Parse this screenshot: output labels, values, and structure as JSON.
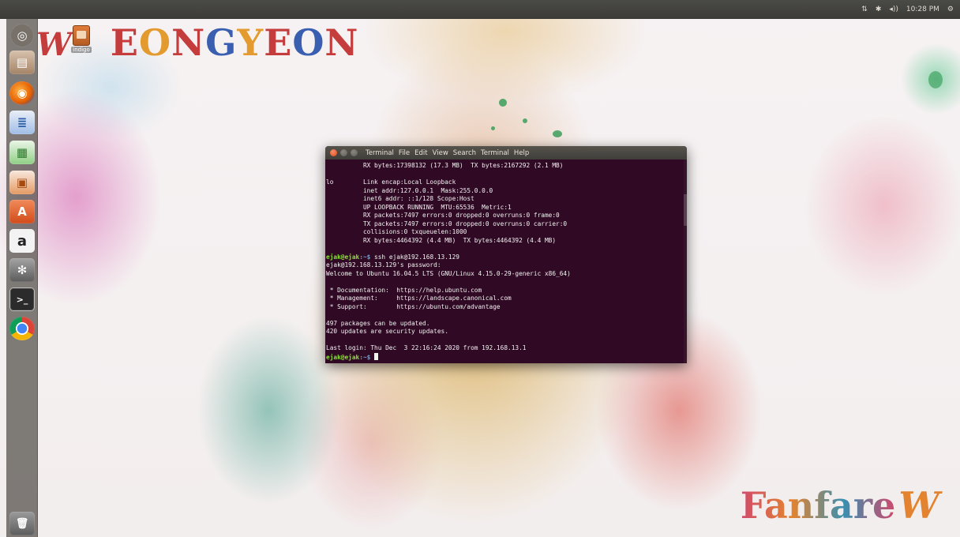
{
  "top_panel": {
    "indicators": {
      "network": "⇅",
      "bluetooth": "✱",
      "volume": "◂))",
      "clock": "10:28 PM",
      "settings": "⚙"
    }
  },
  "launcher": {
    "items": [
      {
        "name": "dash-home",
        "icon": "ubuntu-logo-icon",
        "glyph": "◎",
        "color": "#6b6660"
      },
      {
        "name": "files",
        "icon": "folder-icon",
        "glyph": "▤",
        "color": "#c9a98a"
      },
      {
        "name": "firefox",
        "icon": "firefox-icon",
        "glyph": "◉",
        "color": "#e66000"
      },
      {
        "name": "writer",
        "icon": "document-icon",
        "glyph": "≣",
        "color": "#3f7fc8"
      },
      {
        "name": "calc",
        "icon": "spreadsheet-icon",
        "glyph": "▦",
        "color": "#3e9a3a"
      },
      {
        "name": "impress",
        "icon": "presentation-icon",
        "glyph": "▣",
        "color": "#c55a11"
      },
      {
        "name": "software",
        "icon": "software-center-icon",
        "glyph": "A",
        "color": "#e9643a"
      },
      {
        "name": "amazon",
        "icon": "amazon-icon",
        "glyph": "a",
        "color": "#eeeeee"
      },
      {
        "name": "settings",
        "icon": "system-settings-icon",
        "glyph": "✻",
        "color": "#8c8c8c"
      },
      {
        "name": "terminal",
        "icon": "terminal-icon",
        "glyph": ">_",
        "color": "#2c2c2c"
      },
      {
        "name": "chrome",
        "icon": "chrome-icon",
        "glyph": "◉",
        "color": "#dd4b39"
      },
      {
        "name": "trash",
        "icon": "trash-icon",
        "glyph": "🗑",
        "color": "#777777"
      }
    ]
  },
  "desktop_icon": {
    "label": "indigo",
    "icon": "package-icon"
  },
  "brand_top": {
    "letters": [
      "E",
      "O",
      "N",
      "G",
      "Y",
      "E",
      "O",
      "N"
    ],
    "colors": [
      "#c43c3c",
      "#e39a2f",
      "#c43c3c",
      "#3a5fb0",
      "#e39a2f",
      "#c43c3c",
      "#3a5fb0",
      "#c43c3c"
    ],
    "logo": "W"
  },
  "brand_bottom": {
    "text": "Fanfare",
    "logo": "W"
  },
  "terminal": {
    "menu": [
      "Terminal",
      "File",
      "Edit",
      "View",
      "Search",
      "Terminal",
      "Help"
    ],
    "lines": [
      "          RX bytes:17398132 (17.3 MB)  TX bytes:2167292 (2.1 MB)",
      "",
      "lo        Link encap:Local Loopback",
      "          inet addr:127.0.0.1  Mask:255.0.0.0",
      "          inet6 addr: ::1/128 Scope:Host",
      "          UP LOOPBACK RUNNING  MTU:65536  Metric:1",
      "          RX packets:7497 errors:0 dropped:0 overruns:0 frame:0",
      "          TX packets:7497 errors:0 dropped:0 overruns:0 carrier:0",
      "          collisions:0 txqueuelen:1000",
      "          RX bytes:4464392 (4.4 MB)  TX bytes:4464392 (4.4 MB)",
      ""
    ],
    "prompt1": {
      "user": "ejak@ejak",
      "path": ":~$",
      "command": " ssh ejak@192.168.13.129"
    },
    "lines2": [
      "ejak@192.168.13.129's password:",
      "Welcome to Ubuntu 16.04.5 LTS (GNU/Linux 4.15.0-29-generic x86_64)",
      "",
      " * Documentation:  https://help.ubuntu.com",
      " * Management:     https://landscape.canonical.com",
      " * Support:        https://ubuntu.com/advantage",
      "",
      "497 packages can be updated.",
      "420 updates are security updates.",
      "",
      "Last login: Thu Dec  3 22:16:24 2020 from 192.168.13.1"
    ],
    "prompt2": {
      "user": "ejak@ejak",
      "path": ":~$",
      "command": " "
    }
  }
}
